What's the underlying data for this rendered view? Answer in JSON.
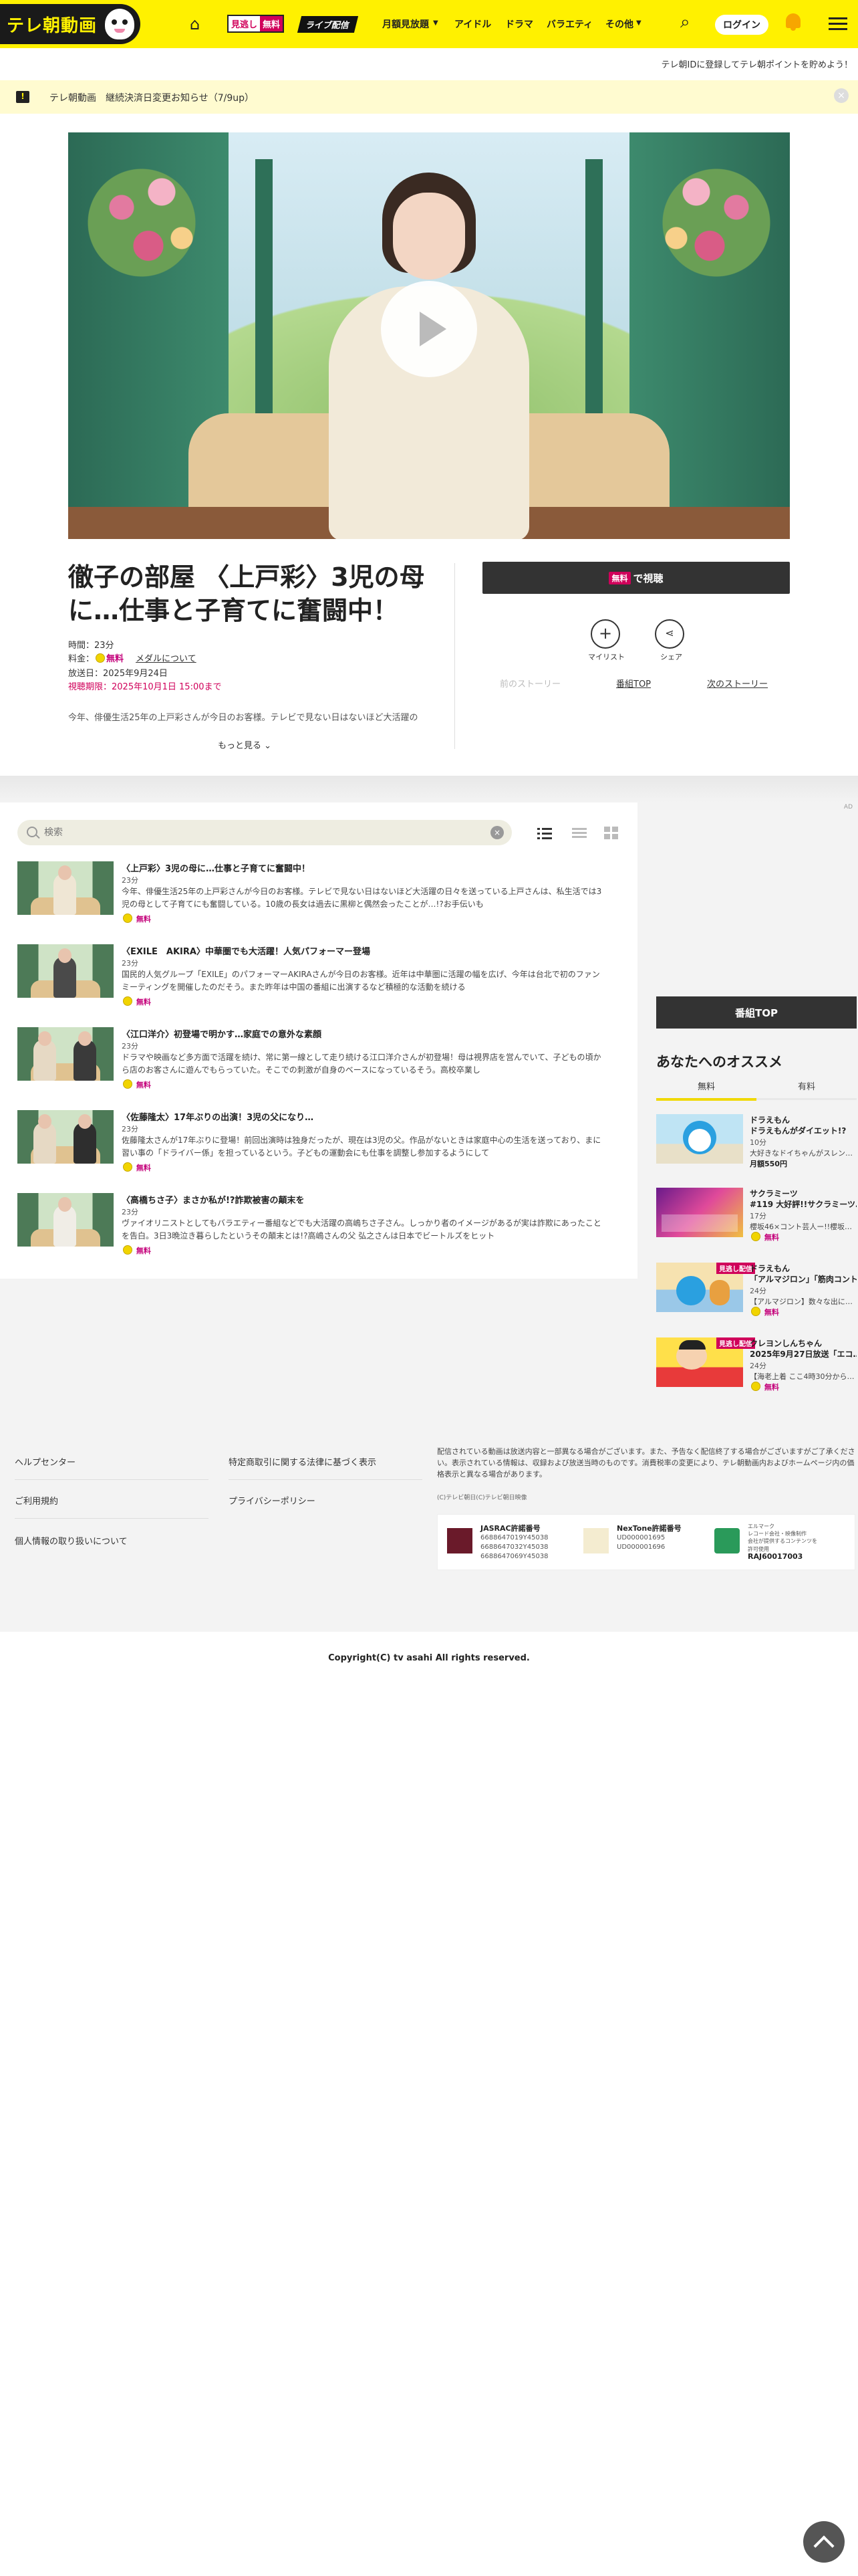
{
  "header": {
    "logo_text": "テレ朝動画",
    "free_badge_left": "見逃し",
    "free_badge_right": "無料",
    "live_badge": "ライブ配信",
    "nav": [
      "月額見放題",
      "アイドル",
      "ドラマ",
      "バラエティ",
      "その他"
    ],
    "login_label": "ログイン",
    "sub_message": "テレ朝IDに登録してテレ朝ポイントを貯めよう！"
  },
  "notice": {
    "icon_label": "!",
    "text": "テレ朝動画　継続決済日変更お知らせ（7/9up）"
  },
  "program": {
    "title": "徹子の部屋 〈上戸彩〉3児の母に…仕事と子育てに奮闘中！",
    "duration": "時間：23分",
    "price_label": "料金：",
    "price_value": "無料",
    "medal_link": "メダルについて",
    "broadcast_date": "放送日：2025年9月24日",
    "deadline": "視聴期限：2025年10月1日 15:00まで",
    "description": "今年、俳優生活25年の上戸彩さんが今日のお客様。テレビで見ない日はないほど大活躍の",
    "more_label": "もっと見る"
  },
  "actions": {
    "watch_tag": "無料",
    "watch_label": "で視聴",
    "mylist_label": "マイリスト",
    "share_label": "シェア",
    "prev_story": "前のストーリー",
    "program_top": "番組TOP",
    "next_story": "次のストーリー"
  },
  "episode_list": {
    "search_placeholder": "検索",
    "episodes": [
      {
        "title": "〈上戸彩〉3児の母に…仕事と子育てに奮闘中！",
        "duration": "23分",
        "summary": "今年、俳優生活25年の上戸彩さんが今日のお客様。テレビで見ない日はないほど大活躍の日々を送っている上戸さんは、私生活では3児の母として子育てにも奮闘している。10歳の長女は過去に黒柳と偶然会ったことが…!?お手伝いも",
        "price": "無料"
      },
      {
        "title": "〈EXILE　AKIRA〉中華圏でも大活躍！人気パフォーマー登場",
        "duration": "23分",
        "summary": "国民的人気グループ「EXILE」のパフォーマーAKIRAさんが今日のお客様。近年は中華圏に活躍の幅を広げ、今年は台北で初のファンミーティングを開催したのだそう。また昨年は中国の番組に出演するなど積極的な活動を続ける",
        "price": "無料"
      },
      {
        "title": "〈江口洋介〉初登場で明かす…家庭での意外な素顔",
        "duration": "23分",
        "summary": "ドラマや映画など多方面で活躍を続け、常に第一線として走り続ける江口洋介さんが初登場！母は視界店を営んでいて、子どもの頃から店のお客さんに遊んでもらっていた。そこでの刺激が自身のベースになっているそう。高校卒業し",
        "price": "無料"
      },
      {
        "title": "〈佐藤隆太〉17年ぶりの出演！3児の父になり…",
        "duration": "23分",
        "summary": "佐藤隆太さんが17年ぶりに登場！前回出演時は独身だったが、現在は3児の父。作品がないときは家庭中心の生活を送っており、まに習い事の「ドライバー係」を担っているという。子どもの運動会にも仕事を調整し参加するようにして",
        "price": "無料"
      },
      {
        "title": "〈高橋ちさ子〉まさか私が!?詐欺被害の顛末を",
        "duration": "23分",
        "summary": "ヴァイオリニストとしてもバラエティー番組などでも大活躍の高嶋ちさ子さん。しっかり者のイメージがあるが実は詐欺にあったことを告白。3日3晩泣き暮らしたというその顛末とは!?高嶋さんの父 弘之さんは日本でビートルズをヒット",
        "price": "無料"
      }
    ]
  },
  "sidebar": {
    "ad_mark": "AD",
    "program_top_button": "番組TOP",
    "recommend_title": "あなたへのオススメ",
    "tabs": [
      "無料",
      "有料"
    ],
    "items": [
      {
        "label": "",
        "title": "ドラえもん",
        "title2": "ドラえもんがダイエット!?",
        "duration": "10分",
        "summary": "大好きなドイちゃんがスレン…",
        "price": "月額550円"
      },
      {
        "label": "",
        "title": "サクラミーツ",
        "title2": "#119 大好評!!サクラミーツ…",
        "duration": "17分",
        "summary": "櫻坂46×コント芸人ー!!櫻坂…",
        "price": "無料"
      },
      {
        "label": "見逃し配信",
        "title": "ドラえもん",
        "title2": "「アルマジロン」「筋肉コント…",
        "duration": "24分",
        "summary": "【アルマジロン】数々な出に…",
        "price": "無料"
      },
      {
        "label": "見逃し配信",
        "title": "クレヨンしんちゃん",
        "title2": "2025年9月27日放送「エコ…",
        "duration": "24分",
        "summary": "【海老上着 ここ4時30分から…",
        "price": "無料"
      }
    ]
  },
  "footer": {
    "links_left": [
      "ヘルプセンター",
      "ご利用規約",
      "個人情報の取り扱いについて"
    ],
    "links_right": [
      "特定商取引に関する法律に基づく表示",
      "プライバシーポリシー"
    ],
    "note": "配信されている動画は放送内容と一部異なる場合がございます。また、予告なく配信終了する場合がございますがご了承ください。表示されている情報は、収録および放送当時のものです。消費税率の変更により、テレ朝動画内およびホームページ内の価格表示と異なる場合があります。",
    "small_copy": "(C)テレビ朝日(C)テレビ朝日映像",
    "certs": [
      {
        "title": "JASRAC許諾番号",
        "numbers": [
          "6688647019Y45038",
          "6688647032Y45038",
          "6688647069Y45038"
        ]
      },
      {
        "title": "NexTone許諾番号",
        "numbers": [
          "UD000001695",
          "UD000001696"
        ]
      },
      {
        "title": "",
        "numbers": [
          "エルマーク",
          "レコード会社・映像制作",
          "会社が提供するコンテンツを",
          "許可使用"
        ],
        "code": "RAJ60017003"
      }
    ],
    "copyright": "Copyright(C) tv asahi All rights reserved."
  }
}
